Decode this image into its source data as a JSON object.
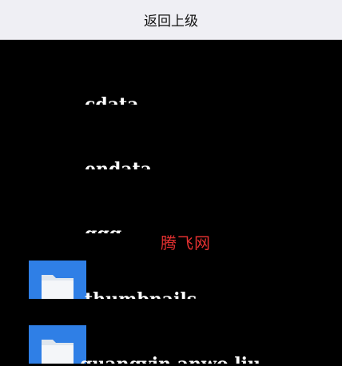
{
  "header": {
    "back_label": "返回上级"
  },
  "files": [
    {
      "name": "cdata",
      "icon": "none"
    },
    {
      "name": "endata",
      "icon": "none"
    },
    {
      "name": "ggg",
      "icon": "none"
    },
    {
      "name": "thumbnails",
      "icon": "folder-icon"
    },
    {
      "name": "guangyin anwo liu",
      "icon": "folder-icon"
    }
  ],
  "watermark": "腾飞网",
  "colors": {
    "background": "#000000",
    "header_bg": "#efeff4",
    "folder_blue": "#2f7fe6",
    "watermark_red": "#e23030"
  }
}
